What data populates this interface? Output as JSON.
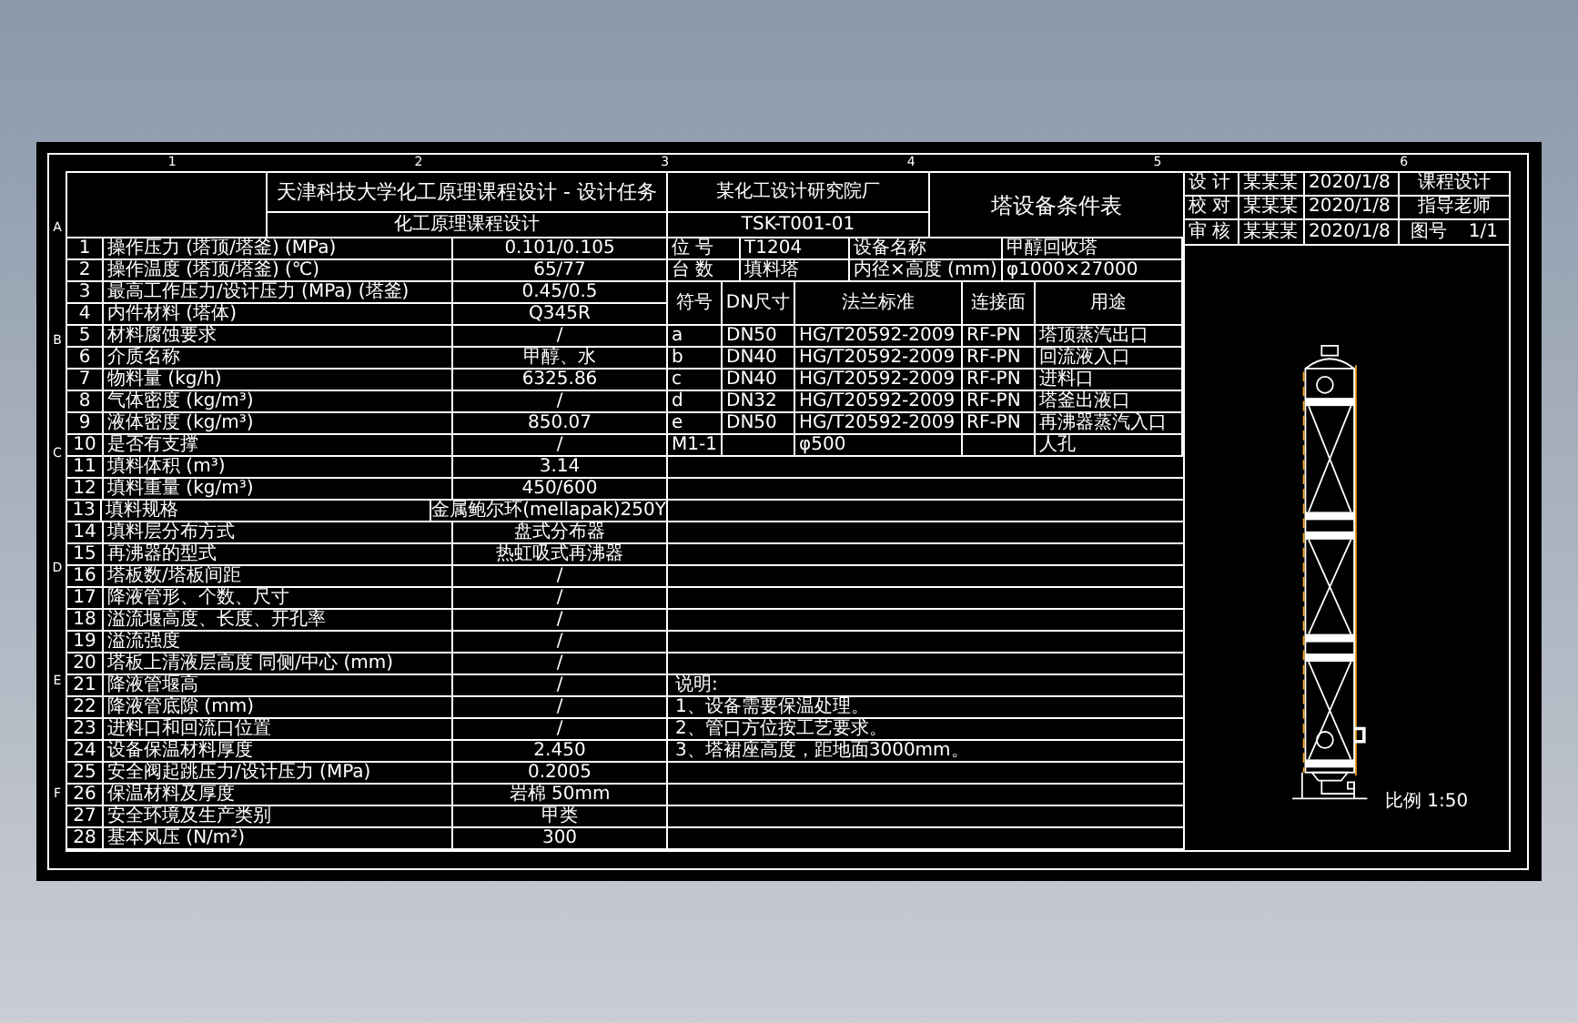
{
  "frame": {
    "top_numbers": [
      "1",
      "2",
      "3",
      "4",
      "5",
      "6"
    ],
    "left_letters": [
      "A",
      "B",
      "C",
      "D",
      "E",
      "F"
    ]
  },
  "header": {
    "left_title": "天津科技大学化工原理课程设计 - 设计任务",
    "left_subtitle": "化工原理课程设计",
    "middle_title": "某化工设计研究院厂",
    "middle_code": "TSK-T001-01",
    "sheet_title": "塔设备条件表"
  },
  "title_block": {
    "rows": [
      [
        "设 计",
        "某某某",
        "2020/1/8"
      ],
      [
        "校 对",
        "某某某",
        "2020/1/8"
      ],
      [
        "审 核",
        "某某某",
        "2020/1/8"
      ]
    ],
    "side_top": [
      "课程设计",
      "指导老师"
    ],
    "side_bottom": [
      "图号",
      "1/1"
    ]
  },
  "specs": [
    {
      "no": "1",
      "item": "操作压力 (塔顶/塔釜) (MPa)",
      "value": "0.101/0.105"
    },
    {
      "no": "2",
      "item": "操作温度 (塔顶/塔釜) (℃)",
      "value": "65/77"
    },
    {
      "no": "3",
      "item": "最高工作压力/设计压力 (MPa) (塔釜)",
      "value": "0.45/0.5"
    },
    {
      "no": "4",
      "item": "内件材料 (塔体)",
      "value": "Q345R"
    },
    {
      "no": "5",
      "item": "材料腐蚀要求",
      "value": "/"
    },
    {
      "no": "6",
      "item": "介质名称",
      "value": "甲醇、水"
    },
    {
      "no": "7",
      "item": "物料量 (kg/h)",
      "value": "6325.86"
    },
    {
      "no": "8",
      "item": "气体密度 (kg/m³)",
      "value": "/"
    },
    {
      "no": "9",
      "item": "液体密度 (kg/m³)",
      "value": "850.07"
    },
    {
      "no": "10",
      "item": "是否有支撑",
      "value": "/"
    },
    {
      "no": "11",
      "item": "填料体积 (m³)",
      "value": "3.14"
    },
    {
      "no": "12",
      "item": "填料重量 (kg/m³)",
      "value": "450/600"
    },
    {
      "no": "13",
      "item": "填料规格",
      "value": "金属鲍尔环(mellapak)250Y"
    },
    {
      "no": "14",
      "item": "填料层分布方式",
      "value": "盘式分布器"
    },
    {
      "no": "15",
      "item": "再沸器的型式",
      "value": "热虹吸式再沸器"
    },
    {
      "no": "16",
      "item": "塔板数/塔板间距",
      "value": "/"
    },
    {
      "no": "17",
      "item": "降液管形、个数、尺寸",
      "value": "/"
    },
    {
      "no": "18",
      "item": "溢流堰高度、长度、开孔率",
      "value": "/"
    },
    {
      "no": "19",
      "item": "溢流强度",
      "value": "/"
    },
    {
      "no": "20",
      "item": "塔板上清液层高度 同侧/中心 (mm)",
      "value": "/"
    },
    {
      "no": "21",
      "item": "降液管堰高",
      "value": "/"
    },
    {
      "no": "22",
      "item": "降液管底隙 (mm)",
      "value": "/"
    },
    {
      "no": "23",
      "item": "进料口和回流口位置",
      "value": "/"
    },
    {
      "no": "24",
      "item": "设备保温材料厚度",
      "value": "2.450"
    },
    {
      "no": "25",
      "item": "安全阀起跳压力/设计压力 (MPa)",
      "value": "0.2005"
    },
    {
      "no": "26",
      "item": "保温材料及厚度",
      "value": "岩棉 50mm"
    },
    {
      "no": "27",
      "item": "安全环境及生产类别",
      "value": "甲类"
    },
    {
      "no": "28",
      "item": "基本风压 (N/m²)",
      "value": "300"
    }
  ],
  "design": [
    [
      "位 号",
      "T1204",
      "设备名称",
      "甲醇回收塔"
    ],
    [
      "台 数",
      "填料塔",
      "内径×高度 (mm)",
      "φ1000×27000"
    ]
  ],
  "nozzles": {
    "columns": [
      "符号",
      "DN尺寸",
      "法兰标准",
      "连接面",
      "用途"
    ],
    "rows": [
      [
        "a",
        "DN50",
        "HG/T20592-2009",
        "RF-PN",
        "塔顶蒸汽出口"
      ],
      [
        "b",
        "DN40",
        "HG/T20592-2009",
        "RF-PN",
        "回流液入口"
      ],
      [
        "c",
        "DN40",
        "HG/T20592-2009",
        "RF-PN",
        "进料口"
      ],
      [
        "d",
        "DN32",
        "HG/T20592-2009",
        "RF-PN",
        "塔釜出液口"
      ],
      [
        "e",
        "DN50",
        "HG/T20592-2009",
        "RF-PN",
        "再沸器蒸汽入口"
      ],
      [
        "M1-1",
        "",
        "φ500",
        "",
        "人孔"
      ]
    ]
  },
  "notes": {
    "heading": "说明:",
    "items": [
      "1、设备需要保温处理。",
      "2、管口方位按工艺要求。",
      "3、塔裙座高度，距地面3000mm。"
    ]
  },
  "scale_label": "比例 1:50"
}
